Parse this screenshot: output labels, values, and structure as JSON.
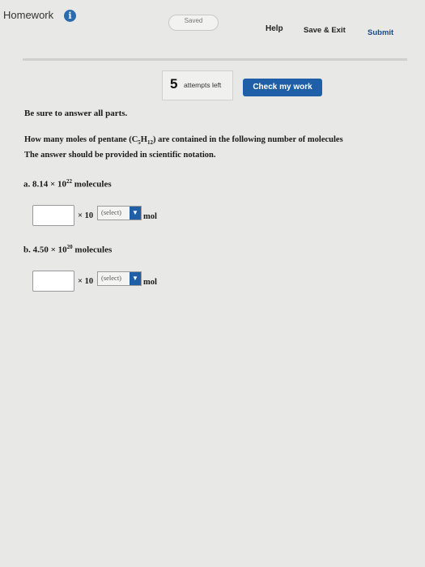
{
  "header": {
    "title": "Homework",
    "info_glyph": "i",
    "saved_label": "Saved",
    "help_label": "Help",
    "save_exit_label": "Save & Exit",
    "submit_label": "Submit"
  },
  "attempts": {
    "count": "5",
    "label": "attempts left",
    "check_label": "Check my work"
  },
  "content": {
    "instruction": "Be sure to answer all parts.",
    "question_pre": "How many moles of pentane (C",
    "question_sub1": "5",
    "question_mid": "H",
    "question_sub2": "12",
    "question_post": ") are contained in the following number of molecules",
    "question_line2": "The answer should be provided in scientific notation.",
    "parts": [
      {
        "prefix": "a.",
        "mantissa": "8.14 × 10",
        "exponent": "22",
        "suffix": "molecules",
        "answer_value": "",
        "times_ten": "× 10",
        "select_value": "(select)",
        "unit": "mol"
      },
      {
        "prefix": "b.",
        "mantissa": "4.50 × 10",
        "exponent": "20",
        "suffix": "molecules",
        "answer_value": "",
        "times_ten": "× 10",
        "select_value": "(select)",
        "unit": "mol"
      }
    ]
  },
  "colors": {
    "accent": "#1f5fa8",
    "page_bg": "#e8e8e6"
  }
}
